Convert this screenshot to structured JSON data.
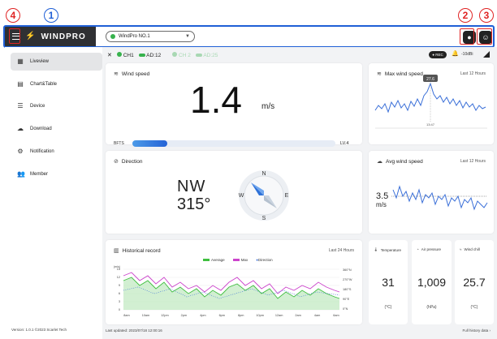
{
  "markers": {
    "m1": "1",
    "m2": "2",
    "m3": "3",
    "m4": "4"
  },
  "header": {
    "brand": "WINDPRO",
    "device_name": "WindPro NO.1"
  },
  "sidebar": {
    "items": [
      {
        "label": "Liveview"
      },
      {
        "label": "Chart&Table"
      },
      {
        "label": "Device"
      },
      {
        "label": "Download"
      },
      {
        "label": "Notification"
      },
      {
        "label": "Member"
      }
    ],
    "version": "Version: 1.0.1  ©2023 Scarlet Tech"
  },
  "status": {
    "ch1": "CH1",
    "ad1": "AD:12",
    "ch2": "CH 2",
    "ad2": "AD:25",
    "rec": "● REC",
    "signal": "-10dBi"
  },
  "wind_speed": {
    "title": "Wind speed",
    "value": "1.4",
    "unit": "m/s",
    "bfts_label": "BFTS",
    "bfts_level": 0.17,
    "level": "LV.4"
  },
  "max_wind": {
    "title": "Max wind speed",
    "period": "Last 12 Hours",
    "peak": "27.6",
    "peak_time": "13:47"
  },
  "direction": {
    "title": "Direction",
    "name": "NW",
    "degrees": "315°",
    "n": "N",
    "s": "S",
    "e": "E",
    "w": "W"
  },
  "avg_wind": {
    "title": "Avg wind speed",
    "period": "Last 12 Hours",
    "value": "3.5",
    "unit": "m/s"
  },
  "history": {
    "title": "Historical record",
    "period": "Last 24 Hours",
    "legend": {
      "avg": "Average",
      "max": "Max",
      "dir": "Direction"
    },
    "y_unit": "(m/s)",
    "y_ticks": [
      "15",
      "12",
      "9",
      "6",
      "3",
      "0"
    ],
    "dir_ticks": [
      "360°N",
      "270°W",
      "180°S",
      "90°E",
      "0°N"
    ],
    "x_ticks": [
      "8am",
      "10am",
      "12pm",
      "2pm",
      "4pm",
      "6pm",
      "8pm",
      "10pm",
      "12am",
      "2am",
      "4am",
      "6am"
    ]
  },
  "temperature": {
    "title": "Temperature",
    "value": "31",
    "unit": "(°C)"
  },
  "air_pressure": {
    "title": "Air pressure",
    "value": "1,009",
    "unit": "(hPa)"
  },
  "wind_chill": {
    "title": "Wind chill",
    "value": "25.7",
    "unit": "(°C)"
  },
  "footer": {
    "updated": "Last updated: 2023/07/18 12:00:16",
    "history": "Full history data ›"
  },
  "colors": {
    "brand_bg": "#2f3033",
    "accent_blue": "#2563d6",
    "green": "#37b24d",
    "max": "#cc44cc",
    "avg": "#3fbf3f"
  }
}
